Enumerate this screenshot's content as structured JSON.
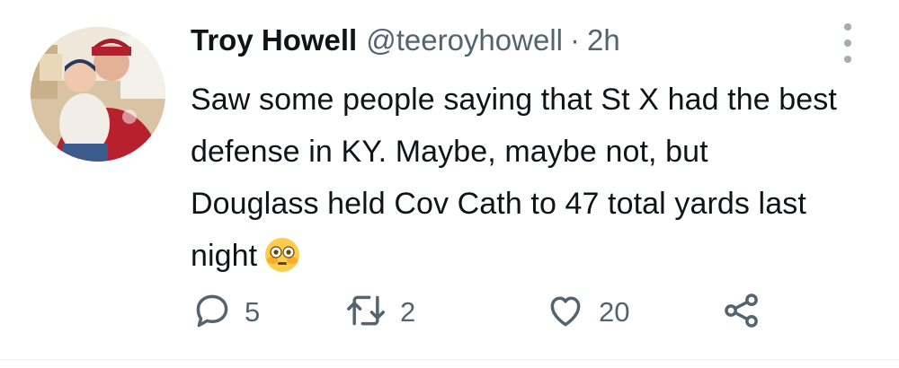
{
  "tweet": {
    "author": {
      "name": "Troy Howell",
      "handle": "@teeroyhowell",
      "separator": "·",
      "time": "2h"
    },
    "text": "Saw some people saying that St X had the best defense in KY. Maybe, maybe not, but Douglass held Cov Cath to 47 total yards last night",
    "emoji": "flushed-face",
    "actions": {
      "replies": "5",
      "retweets": "2",
      "likes": "20"
    }
  },
  "icons": {
    "reply": "speech-bubble-icon",
    "retweet": "retweet-arrows-icon",
    "like": "heart-outline-icon",
    "share": "share-nodes-icon",
    "more": "vertical-dots-icon"
  },
  "colors": {
    "text": "#0f1419",
    "secondary": "#536471",
    "icon": "#536471"
  }
}
